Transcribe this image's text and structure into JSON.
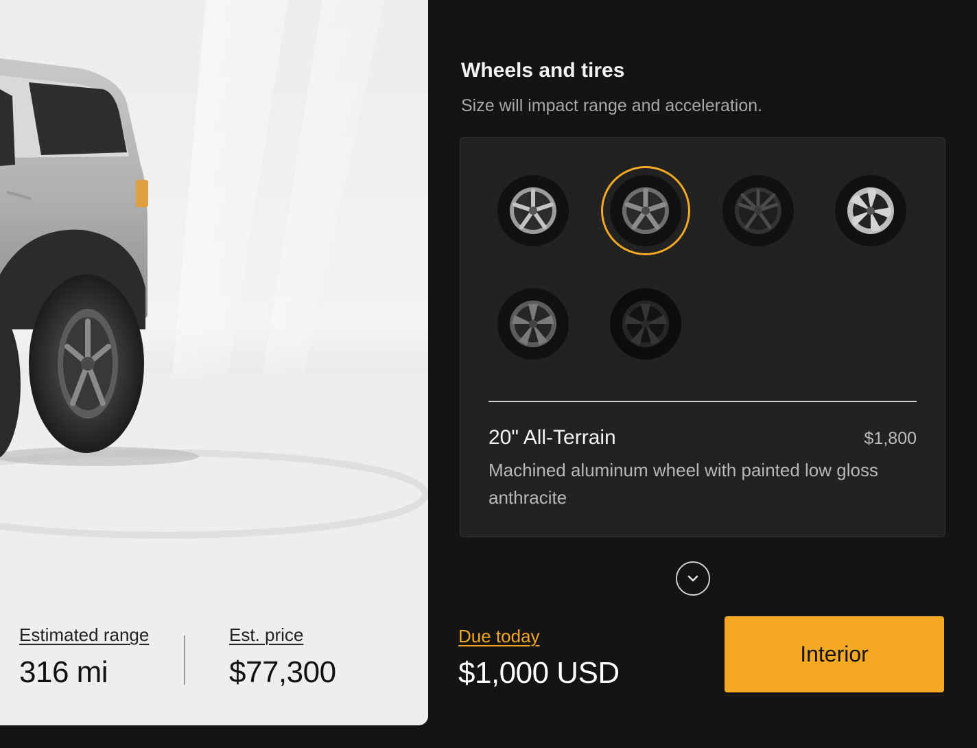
{
  "vehicle_panel": {
    "image_alt": "Silver SUV rear side with all-terrain wheel",
    "stats": [
      {
        "label": "Estimated range",
        "value": "316 mi"
      },
      {
        "label": "Est. price",
        "value": "$77,300"
      }
    ]
  },
  "section": {
    "title": "Wheels and tires",
    "subtitle": "Size will impact range and acceleration."
  },
  "wheel_options": [
    {
      "icon": "wheel-silver-5spoke-icon",
      "selected": false
    },
    {
      "icon": "wheel-all-terrain-anthracite-icon",
      "selected": true
    },
    {
      "icon": "wheel-dark-multispoke-icon",
      "selected": false
    },
    {
      "icon": "wheel-silver-swirl-icon",
      "selected": false
    },
    {
      "icon": "wheel-gray-5spoke-icon",
      "selected": false
    },
    {
      "icon": "wheel-black-5spoke-icon",
      "selected": false
    }
  ],
  "selected_option": {
    "name": "20\" All-Terrain",
    "price": "$1,800",
    "description": "Machined aluminum wheel with painted low gloss anthracite"
  },
  "scroll_icon": "chevron-down-icon",
  "footer": {
    "due_label": "Due today",
    "due_value": "$1,000 USD",
    "next_button": "Interior"
  },
  "colors": {
    "accent": "#f5a823",
    "background": "#141414",
    "card": "#222222"
  }
}
